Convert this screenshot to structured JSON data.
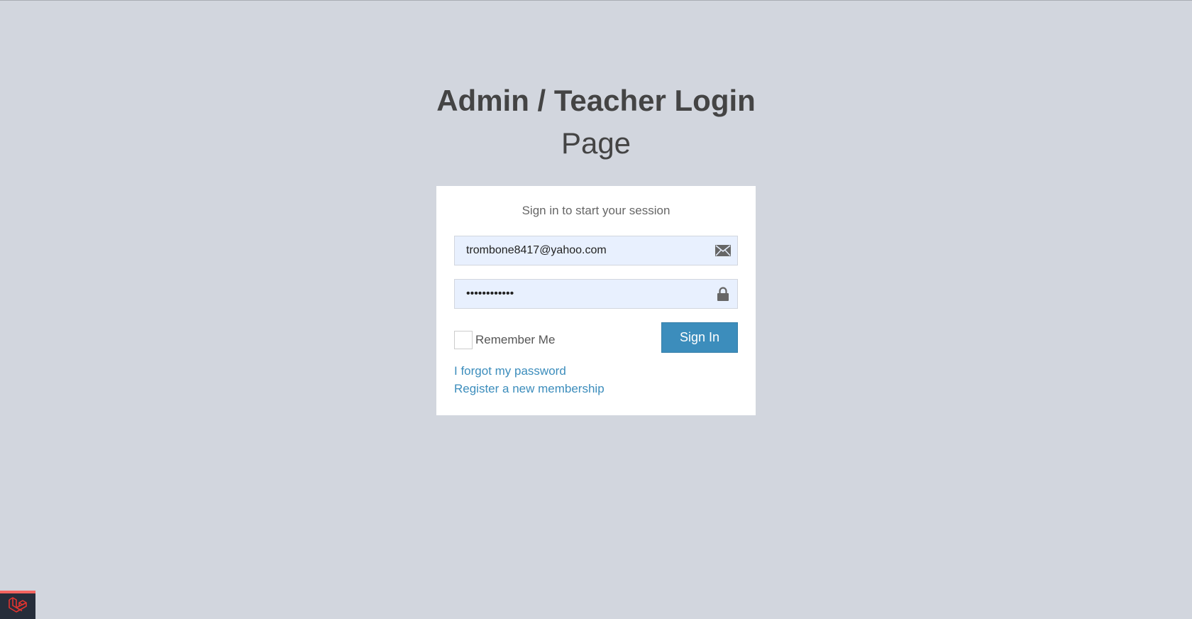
{
  "header": {
    "title_line1": "Admin / Teacher Login",
    "title_line2": "Page"
  },
  "card": {
    "message": "Sign in to start your session",
    "email": {
      "value": "trombone8417@yahoo.com",
      "icon": "envelope-icon"
    },
    "password": {
      "value": "••••••••••••",
      "icon": "lock-icon"
    },
    "remember_label": "Remember Me",
    "remember_checked": false,
    "signin_label": "Sign In",
    "forgot_link": "I forgot my password",
    "register_link": "Register a new membership"
  },
  "debugbar": {
    "icon": "laravel-logo-icon",
    "accent_color": "#f4645f"
  },
  "colors": {
    "background": "#d2d6de",
    "primary": "#3c8dbc",
    "input_bg": "#e8f0fe"
  }
}
